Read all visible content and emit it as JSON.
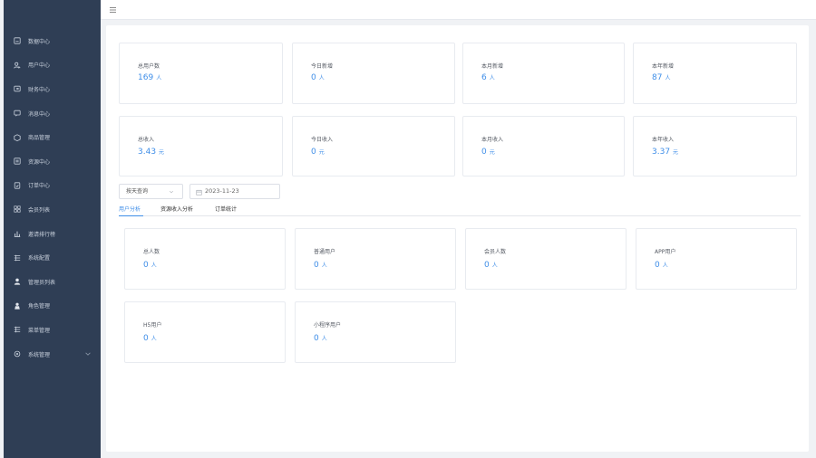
{
  "sidebar": {
    "items": [
      {
        "label": "数据中心",
        "icon": "dashboard-icon"
      },
      {
        "label": "用户中心",
        "icon": "user-icon"
      },
      {
        "label": "财务中心",
        "icon": "wallet-icon"
      },
      {
        "label": "消息中心",
        "icon": "message-icon"
      },
      {
        "label": "商品管理",
        "icon": "box-icon"
      },
      {
        "label": "资源中心",
        "icon": "folder-icon"
      },
      {
        "label": "订单中心",
        "icon": "order-icon"
      },
      {
        "label": "会员列表",
        "icon": "member-icon"
      },
      {
        "label": "邀请排行榜",
        "icon": "bar-chart-icon"
      },
      {
        "label": "系统配置",
        "icon": "list-icon"
      },
      {
        "label": "管理员列表",
        "icon": "admin-icon"
      },
      {
        "label": "角色管理",
        "icon": "role-icon"
      },
      {
        "label": "菜单管理",
        "icon": "menu-list-icon"
      },
      {
        "label": "系统管理",
        "icon": "settings-icon"
      }
    ]
  },
  "stats_row1": [
    {
      "label": "总用户数",
      "value": "169",
      "unit": "人"
    },
    {
      "label": "今日新增",
      "value": "0",
      "unit": "人"
    },
    {
      "label": "本月新增",
      "value": "6",
      "unit": "人"
    },
    {
      "label": "本年新增",
      "value": "87",
      "unit": "人"
    }
  ],
  "stats_row2": [
    {
      "label": "总收入",
      "value": "3.43",
      "unit": "元"
    },
    {
      "label": "今日收入",
      "value": "0",
      "unit": "元"
    },
    {
      "label": "本月收入",
      "value": "0",
      "unit": "元"
    },
    {
      "label": "本年收入",
      "value": "3.37",
      "unit": "元"
    }
  ],
  "filter": {
    "select_value": "按天查询",
    "date_value": "2023-11-23"
  },
  "tabs": [
    {
      "label": "用户分析",
      "active": true
    },
    {
      "label": "资源收入分析",
      "active": false
    },
    {
      "label": "订单统计",
      "active": false
    }
  ],
  "stats_row3": [
    {
      "label": "总人数",
      "value": "0",
      "unit": "人"
    },
    {
      "label": "普通用户",
      "value": "0",
      "unit": "人"
    },
    {
      "label": "会员人数",
      "value": "0",
      "unit": "人"
    },
    {
      "label": "APP用户",
      "value": "0",
      "unit": "人"
    }
  ],
  "stats_row4": [
    {
      "label": "H5用户",
      "value": "0",
      "unit": "人"
    },
    {
      "label": "小程序用户",
      "value": "0",
      "unit": "人"
    }
  ],
  "colors": {
    "sidebar_bg": "#2f3e55",
    "accent": "#3f8ee8",
    "page_bg": "#f0f2f5"
  }
}
